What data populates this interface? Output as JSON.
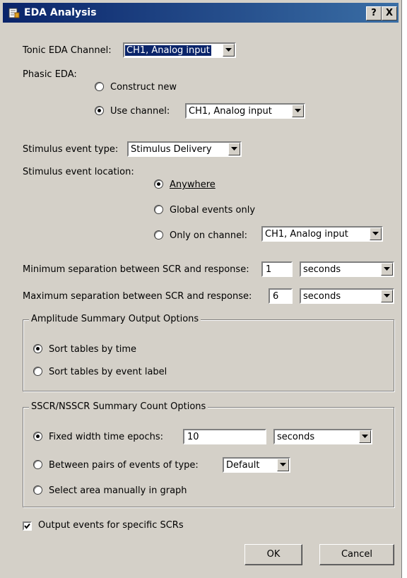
{
  "window": {
    "title": "EDA Analysis",
    "help_label": "?",
    "close_label": "X"
  },
  "tonic": {
    "label": "Tonic EDA Channel:",
    "value": "CH1, Analog input"
  },
  "phasic": {
    "label": "Phasic EDA:",
    "construct_label": "Construct new",
    "use_label": "Use channel:",
    "channel_value": "CH1, Analog input"
  },
  "stimulus": {
    "type_label": "Stimulus event type:",
    "type_value": "Stimulus Delivery",
    "location_label": "Stimulus event location:",
    "anywhere_label": "Anywhere",
    "global_label": "Global events only",
    "onchannel_label": "Only on channel:",
    "onchannel_value": "CH1, Analog input"
  },
  "separation": {
    "min_label": "Minimum separation between SCR and response:",
    "min_value": "1",
    "min_unit": "seconds",
    "max_label": "Maximum separation between SCR and response:",
    "max_value": "6",
    "max_unit": "seconds"
  },
  "amplitude": {
    "title": "Amplitude Summary Output Options",
    "by_time_label": "Sort tables by time",
    "by_label_label": "Sort tables by event label"
  },
  "sscr": {
    "title": "SSCR/NSSCR Summary Count Options",
    "fixed_label": "Fixed width time epochs:",
    "fixed_value": "10",
    "fixed_unit": "seconds",
    "between_label": "Between pairs of events of type:",
    "between_value": "Default",
    "manual_label": "Select area manually in graph"
  },
  "output_events_label": "Output events for specific SCRs",
  "ok_label": "OK",
  "cancel_label": "Cancel"
}
